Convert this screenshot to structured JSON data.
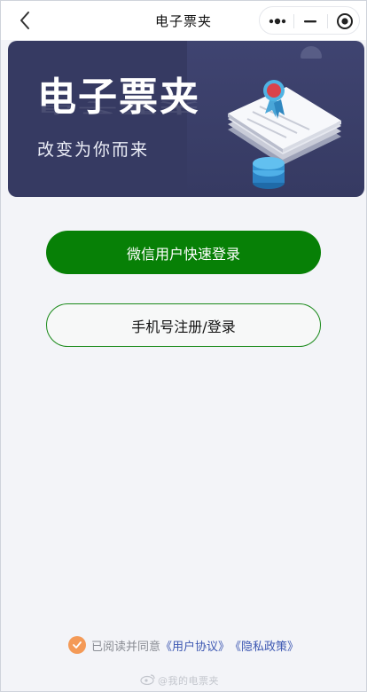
{
  "nav": {
    "title": "电子票夹"
  },
  "banner": {
    "title": "电子票夹",
    "subtitle": "改变为你而来"
  },
  "buttons": {
    "wechat_login": "微信用户快速登录",
    "phone_login": "手机号注册/登录"
  },
  "agreement": {
    "text": "已阅读并同意",
    "user_agreement": "《用户协议》",
    "privacy_policy": "《隐私政策》",
    "checked": true
  },
  "watermark": {
    "text": "@我的电票夹"
  },
  "colors": {
    "primary_green": "#078006",
    "banner_bg": "#363a62",
    "check_orange": "#f49a57",
    "link_blue": "#3c57b2",
    "page_bg": "#f3f4f8"
  },
  "icons": {
    "back": "chevron-left-icon",
    "more": "more-dots-icon",
    "minimize": "minimize-icon",
    "close": "target-circle-icon",
    "check": "check-circle-icon"
  }
}
